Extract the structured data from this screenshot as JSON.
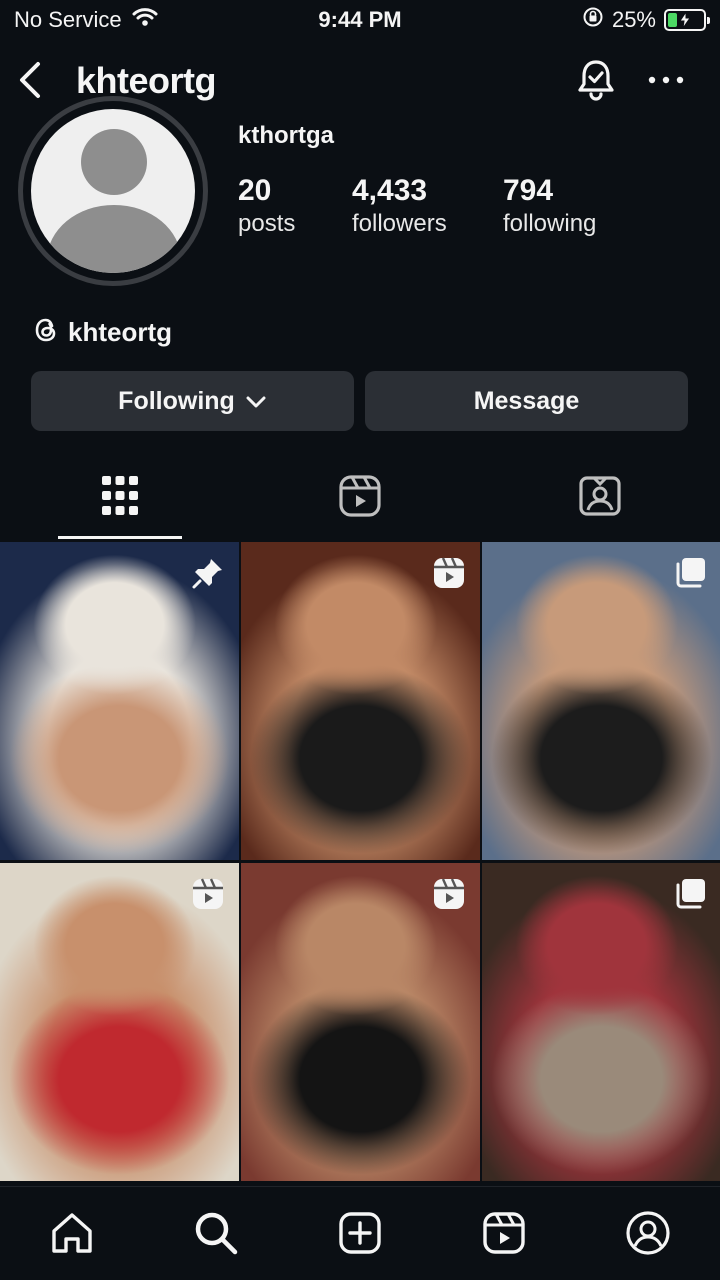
{
  "status_bar": {
    "carrier": "No Service",
    "time": "9:44 PM",
    "battery_percent": "25%",
    "battery_level": 0.25,
    "icons": [
      "wifi-icon",
      "orientation-lock-icon",
      "battery-charging-icon"
    ]
  },
  "header": {
    "username": "khteortg",
    "icons": [
      "back-chevron-icon",
      "notification-bell-icon",
      "more-dots-icon"
    ]
  },
  "profile": {
    "display_name": "kthortga",
    "stats": [
      {
        "value": "20",
        "label": "posts"
      },
      {
        "value": "4,433",
        "label": "followers"
      },
      {
        "value": "794",
        "label": "following"
      }
    ],
    "threads_handle": "khteortg"
  },
  "actions": {
    "following_label": "Following",
    "message_label": "Message"
  },
  "tabs": [
    {
      "name": "posts-grid",
      "icon": "grid-icon",
      "active": true
    },
    {
      "name": "reels",
      "icon": "reels-icon",
      "active": false
    },
    {
      "name": "tagged",
      "icon": "tagged-icon",
      "active": false
    }
  ],
  "posts": [
    {
      "badge": "pin-icon",
      "colors": [
        "#1c2a4a",
        "#e9e4dc",
        "#c99676"
      ]
    },
    {
      "badge": "reel-icon",
      "colors": [
        "#5a2a1c",
        "#c28a66",
        "#1a1a1a"
      ]
    },
    {
      "badge": "carousel-icon",
      "colors": [
        "#5b6f8a",
        "#c79a7a",
        "#1c1c1c"
      ]
    },
    {
      "badge": "reel-icon",
      "colors": [
        "#ddd6c8",
        "#c8906c",
        "#c0292f"
      ]
    },
    {
      "badge": "reel-icon",
      "colors": [
        "#7a3a30",
        "#b98766",
        "#141414"
      ]
    },
    {
      "badge": "carousel-icon",
      "colors": [
        "#3a2a22",
        "#a0343c",
        "#9a8a7a"
      ]
    }
  ],
  "bottom_nav": [
    "home-icon",
    "search-icon",
    "create-icon",
    "reels-icon",
    "profile-icon"
  ]
}
